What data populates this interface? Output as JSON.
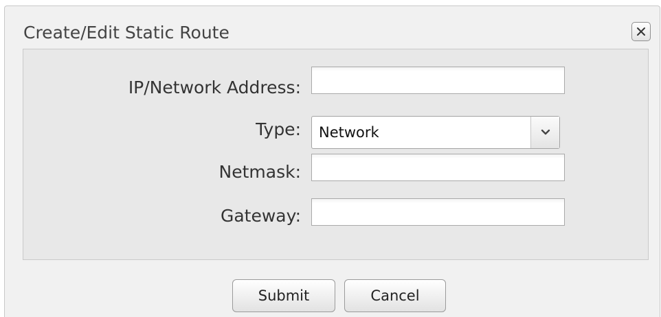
{
  "dialog": {
    "title": "Create/Edit Static Route",
    "close_icon": "close-icon"
  },
  "form": {
    "ip_address": {
      "label": "IP/Network Address:",
      "value": "",
      "placeholder": ""
    },
    "type": {
      "label": "Type:",
      "selected": "Network",
      "icon": "chevron-down-icon"
    },
    "netmask": {
      "label": "Netmask:",
      "value": "",
      "placeholder": ""
    },
    "gateway": {
      "label": "Gateway:",
      "value": "",
      "placeholder": ""
    }
  },
  "buttons": {
    "submit_label": "Submit",
    "cancel_label": "Cancel"
  }
}
